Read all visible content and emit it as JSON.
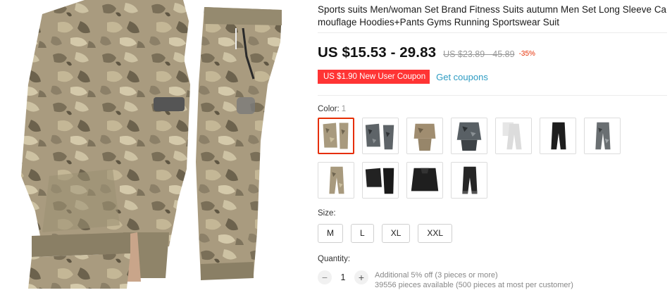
{
  "product": {
    "title": "Sports suits Men/woman Set Brand Fitness Suits autumn Men Set Long Sleeve Camouflage Hoodies+Pants Gyms Running Sportswear Suit",
    "main_image_icon": "camo-tracksuit-photo"
  },
  "price": {
    "current": "US $15.53 - 29.83",
    "original": "US $23.89 - 45.89",
    "discount": "-35%"
  },
  "coupon": {
    "label": "US $1.90 New User Coupon",
    "link": "Get coupons"
  },
  "color": {
    "label": "Color:",
    "selected_value": "1",
    "options": [
      {
        "icon": "camo-tan-set-thumbnail",
        "selected": true
      },
      {
        "icon": "camo-grey-set-thumbnail",
        "selected": false
      },
      {
        "icon": "camo-khaki-set-thumbnail",
        "selected": false
      },
      {
        "icon": "camo-grey-hoodie-thumbnail",
        "selected": false
      },
      {
        "icon": "white-set-thumbnail",
        "selected": false
      },
      {
        "icon": "black-pants-thumbnail",
        "selected": false
      },
      {
        "icon": "grey-camo-pants-thumbnail",
        "selected": false
      },
      {
        "icon": "khaki-pants-thumbnail",
        "selected": false
      },
      {
        "icon": "black-set-thumbnail",
        "selected": false
      },
      {
        "icon": "black-hoodie-thumbnail",
        "selected": false
      },
      {
        "icon": "black-joggers-thumbnail",
        "selected": false
      }
    ]
  },
  "size": {
    "label": "Size:",
    "options": [
      "M",
      "L",
      "XL",
      "XXL"
    ]
  },
  "quantity": {
    "label": "Quantity:",
    "value": "1",
    "minus": "−",
    "plus": "+",
    "note_discount": "Additional 5% off (3 pieces or more)",
    "note_available": "39556 pieces available (500 pieces at most per customer)"
  },
  "colors": {
    "accent": "#e62e04",
    "coupon_bg": "#ff3434",
    "link": "#2e9cc3",
    "camo_base": "#a89a7e",
    "camo_dark": "#6f6550",
    "camo_light": "#cbbf9f"
  }
}
